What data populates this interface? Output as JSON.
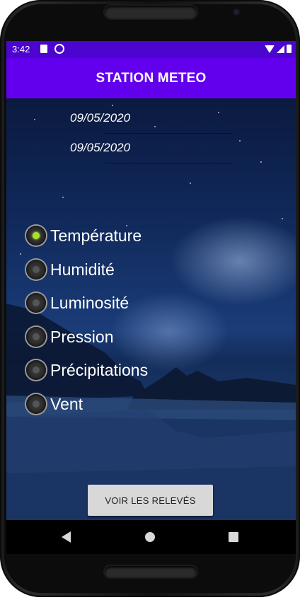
{
  "status_bar": {
    "time": "3:42",
    "left_icons": [
      "sd-card-icon",
      "at-sign-icon"
    ],
    "right_icons": [
      "wifi-icon",
      "signal-icon",
      "battery-icon"
    ]
  },
  "app_bar": {
    "title": "STATION METEO"
  },
  "dates": {
    "start_date": "09/05/2020",
    "end_date": "09/05/2020"
  },
  "options": [
    {
      "label": "Température",
      "checked": true
    },
    {
      "label": "Humidité",
      "checked": false
    },
    {
      "label": "Luminosité",
      "checked": false
    },
    {
      "label": "Pression",
      "checked": false
    },
    {
      "label": "Précipitations",
      "checked": false
    },
    {
      "label": "Vent",
      "checked": false
    }
  ],
  "action": {
    "button_label": "VOIR LES RELEVÉS"
  },
  "colors": {
    "status_bar": "#4b05cf",
    "app_bar": "#6200ee",
    "radio_checked": "#a6e22e"
  },
  "nav_bar": {
    "buttons": [
      "back-icon",
      "home-icon",
      "recents-icon"
    ]
  }
}
